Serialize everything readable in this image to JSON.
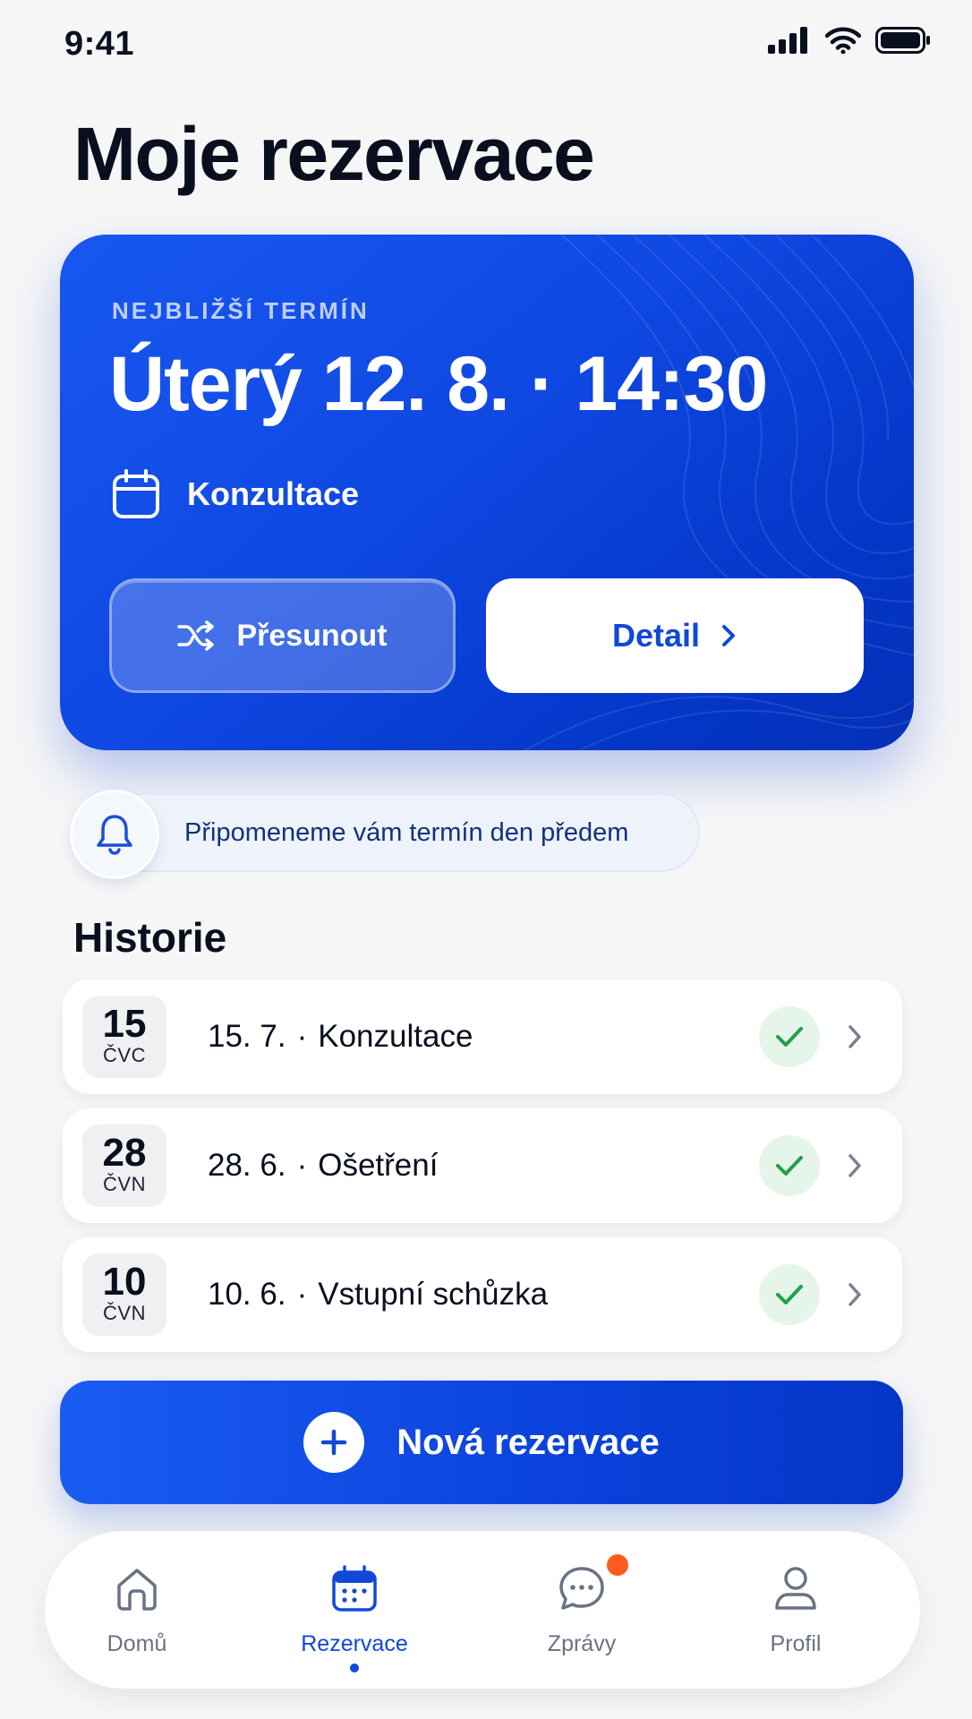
{
  "status_bar": {
    "time": "9:41"
  },
  "page": {
    "title": "Moje rezervace"
  },
  "next_appointment": {
    "eyebrow": "NEJBLIŽŠÍ TERMÍN",
    "datetime": "Úterý 12. 8. · 14:30",
    "type": "Konzultace",
    "type_icon": "calendar-icon",
    "reschedule_label": "Přesunout",
    "reschedule_icon": "shuffle-icon",
    "detail_label": "Detail",
    "detail_icon": "chevron-right-icon"
  },
  "reminder": {
    "text": "Připomeneme vám termín den předem",
    "icon": "bell-icon"
  },
  "history": {
    "title": "Historie",
    "items": [
      {
        "day": "15",
        "month": "ČVC",
        "date": "15. 7.",
        "service": "Konzultace",
        "status": "completed"
      },
      {
        "day": "28",
        "month": "ČVN",
        "date": "28. 6.",
        "service": "Ošetření",
        "status": "completed"
      },
      {
        "day": "10",
        "month": "ČVN",
        "date": "10. 6.",
        "service": "Vstupní schůzka",
        "status": "completed"
      }
    ]
  },
  "new_booking": {
    "label": "Nová rezervace",
    "icon": "plus-icon"
  },
  "tab_bar": {
    "items": [
      {
        "label": "Domů",
        "icon": "home-icon",
        "active": false
      },
      {
        "label": "Rezervace",
        "icon": "calendar-icon",
        "active": true
      },
      {
        "label": "Zprávy",
        "icon": "chat-bubble-icon",
        "active": false,
        "has_notification": true
      },
      {
        "label": "Profil",
        "icon": "user-icon",
        "active": false
      }
    ]
  },
  "colors": {
    "primary": "#1148d8",
    "card_gradient_start": "#1858f0",
    "card_gradient_end": "#0530b6",
    "success": "#22a04a",
    "notification": "#ff5a1f",
    "background": "#f6f6f7"
  }
}
